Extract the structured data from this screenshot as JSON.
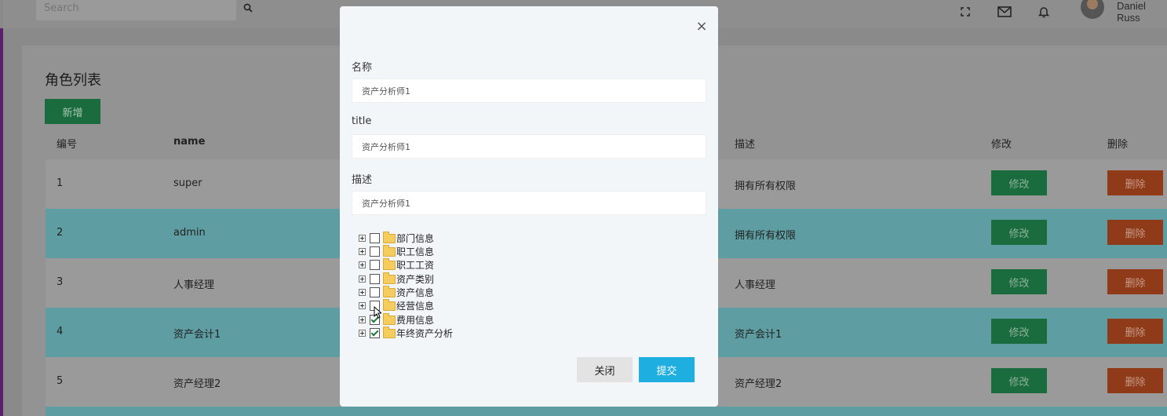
{
  "topbar": {
    "search_placeholder": "Search",
    "user_name": "Daniel Russ"
  },
  "page": {
    "title": "角色列表",
    "add_label": "新增"
  },
  "table": {
    "headers": {
      "id": "编号",
      "name": "name",
      "desc": "描述",
      "edit": "修改",
      "delete": "删除"
    },
    "rows": [
      {
        "id": "1",
        "name": "super",
        "desc": "拥有所有权限",
        "edit": "修改",
        "delete": "删除"
      },
      {
        "id": "2",
        "name": "admin",
        "desc": "拥有所有权限",
        "edit": "修改",
        "delete": "删除"
      },
      {
        "id": "3",
        "name": "人事经理",
        "desc": "人事经理",
        "edit": "修改",
        "delete": "删除"
      },
      {
        "id": "4",
        "name": "资产会计1",
        "desc": "资产会计1",
        "edit": "修改",
        "delete": "删除"
      },
      {
        "id": "5",
        "name": "资产经理2",
        "desc": "资产经理2",
        "edit": "修改",
        "delete": "删除"
      }
    ]
  },
  "modal": {
    "name_label": "名称",
    "name_value": "资产分析师1",
    "title_label": "title",
    "title_value": "资产分析师1",
    "desc_label": "描述",
    "desc_value": "资产分析师1",
    "tree": [
      {
        "label": "部门信息",
        "checked": false
      },
      {
        "label": "职工信息",
        "checked": false
      },
      {
        "label": "职工工资",
        "checked": false
      },
      {
        "label": "资产类别",
        "checked": false
      },
      {
        "label": "资产信息",
        "checked": false
      },
      {
        "label": "经营信息",
        "checked": false
      },
      {
        "label": "费用信息",
        "checked": true
      },
      {
        "label": "年终资产分析",
        "checked": true
      }
    ],
    "close_label": "关闭",
    "submit_label": "提交"
  },
  "colors": {
    "primary_green": "#1a6b3e",
    "danger_orange": "#8f3a18",
    "submit_blue": "#1eaee0"
  }
}
